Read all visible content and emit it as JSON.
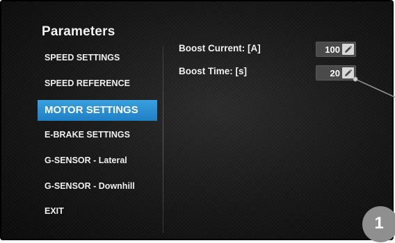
{
  "panel": {
    "title": "Parameters"
  },
  "menu": {
    "items": [
      {
        "label": "SPEED SETTINGS",
        "active": false
      },
      {
        "label": "SPEED REFERENCE",
        "active": false
      },
      {
        "label": "MOTOR SETTINGS",
        "active": true
      },
      {
        "label": "E-BRAKE SETTINGS",
        "active": false
      },
      {
        "label": "G-SENSOR - Lateral",
        "active": false
      },
      {
        "label": "G-SENSOR - Downhill",
        "active": false
      },
      {
        "label": "EXIT",
        "active": false
      }
    ]
  },
  "params": {
    "boost_current": {
      "label": "Boost Current: [A]",
      "value": "100",
      "icon": "pencil-edit-icon"
    },
    "boost_time": {
      "label": "Boost Time: [s]",
      "value": "20",
      "icon": "pencil-edit-icon"
    }
  },
  "callout": {
    "number": "1"
  },
  "colors": {
    "accent": "#2b8fd3",
    "background": "#141414",
    "value_box": "#4a4a4a",
    "badge": "#8f8f8f"
  }
}
